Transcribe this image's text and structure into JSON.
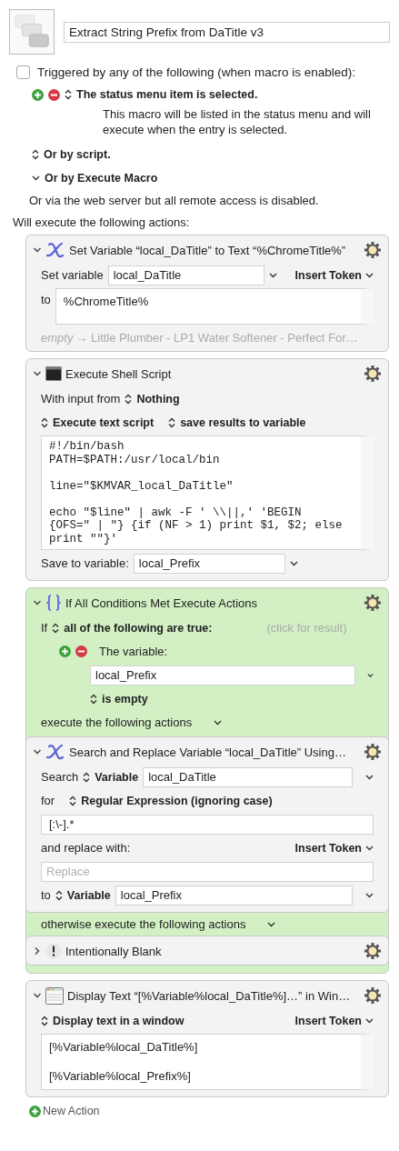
{
  "macro": {
    "name": "Extract String Prefix from DaTitle v3"
  },
  "triggers": {
    "enabled_checkbox": {
      "label": "Triggered by any of the following (when macro is enabled):",
      "checked": false
    },
    "items": [
      {
        "label": "The status menu item is selected.",
        "description": "This macro will be listed in the status menu and will execute when the entry is selected."
      }
    ],
    "or_by_script": "Or by script.",
    "or_by_execute_macro": "Or by Execute Macro",
    "web_server": "Or via the web server but all remote access is disabled."
  },
  "actions_heading": "Will execute the following actions:",
  "actions": [
    {
      "kind": "set_variable",
      "title": "Set Variable “local_DaTitle” to Text “%ChromeTitle%”",
      "expanded": true,
      "variable_label": "Set variable",
      "variable": "local_DaTitle",
      "insert_token": "Insert Token",
      "to_label": "to",
      "text": "%ChromeTitle%",
      "preview_empty": "empty",
      "preview": "→ Little Plumber - LP1 Water Softener - Perfect For…"
    },
    {
      "kind": "shell_script",
      "title": "Execute Shell Script",
      "expanded": true,
      "input_label": "With input from",
      "input": "Nothing",
      "mode": "Execute text script",
      "result": "save results to variable",
      "script": "#!/bin/bash\nPATH=$PATH:/usr/local/bin\n\nline=\"$KMVAR_local_DaTitle\"\n\necho \"$line\" | awk -F ' \\\\||,' 'BEGIN\n{OFS=\" | \"} {if (NF > 1) print $1, $2; else\nprint \"\"}'",
      "save_label": "Save to variable:",
      "variable": "local_Prefix"
    },
    {
      "kind": "if_then",
      "title": "If All Conditions Met Execute Actions",
      "expanded": true,
      "if_label": "If",
      "match": "all of the following are true:",
      "result_hint": "(click for result)",
      "conditions": [
        {
          "label": "The variable:",
          "variable": "local_Prefix",
          "test": "is empty"
        }
      ],
      "then_label": "execute the following actions",
      "then_actions": [
        {
          "kind": "search_replace",
          "title": "Search and Replace Variable “local_DaTitle” Using…",
          "expanded": true,
          "search_label": "Search",
          "source_type": "Variable",
          "source": "local_DaTitle",
          "for_label": "for",
          "match_type": "Regular Expression (ignoring case)",
          "pattern": "[:\\-].*",
          "replace_label": "and replace with:",
          "insert_token": "Insert Token",
          "replace_placeholder": "Replace",
          "to_label": "to",
          "dest_type": "Variable",
          "dest": "local_Prefix"
        }
      ],
      "else_label": "otherwise execute the following actions",
      "else_actions": [
        {
          "kind": "comment",
          "title": "Intentionally Blank",
          "expanded": false
        }
      ]
    },
    {
      "kind": "display_text",
      "title": "Display Text “[%Variable%local_DaTitle%]…” in Win…",
      "expanded": true,
      "mode": "Display text in a window",
      "insert_token": "Insert Token",
      "text": "[%Variable%local_DaTitle%]\n\n[%Variable%local_Prefix%]"
    }
  ],
  "new_action": "New Action"
}
